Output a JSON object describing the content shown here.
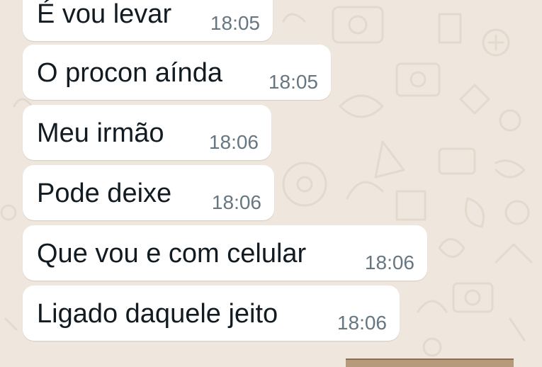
{
  "theme": {
    "wallpaper_color": "#efe7de",
    "bubble_color": "#ffffff",
    "text_color": "#111b21",
    "time_color": "#667781"
  },
  "messages": [
    {
      "text": "É vou levar",
      "time": "18:05"
    },
    {
      "text": "O procon aínda",
      "time": "18:05"
    },
    {
      "text": "Meu irmão",
      "time": "18:06"
    },
    {
      "text": "Pode deixe",
      "time": "18:06"
    },
    {
      "text": "Que vou e com celular",
      "time": "18:06"
    },
    {
      "text": "Ligado daquele jeito",
      "time": "18:06"
    }
  ]
}
